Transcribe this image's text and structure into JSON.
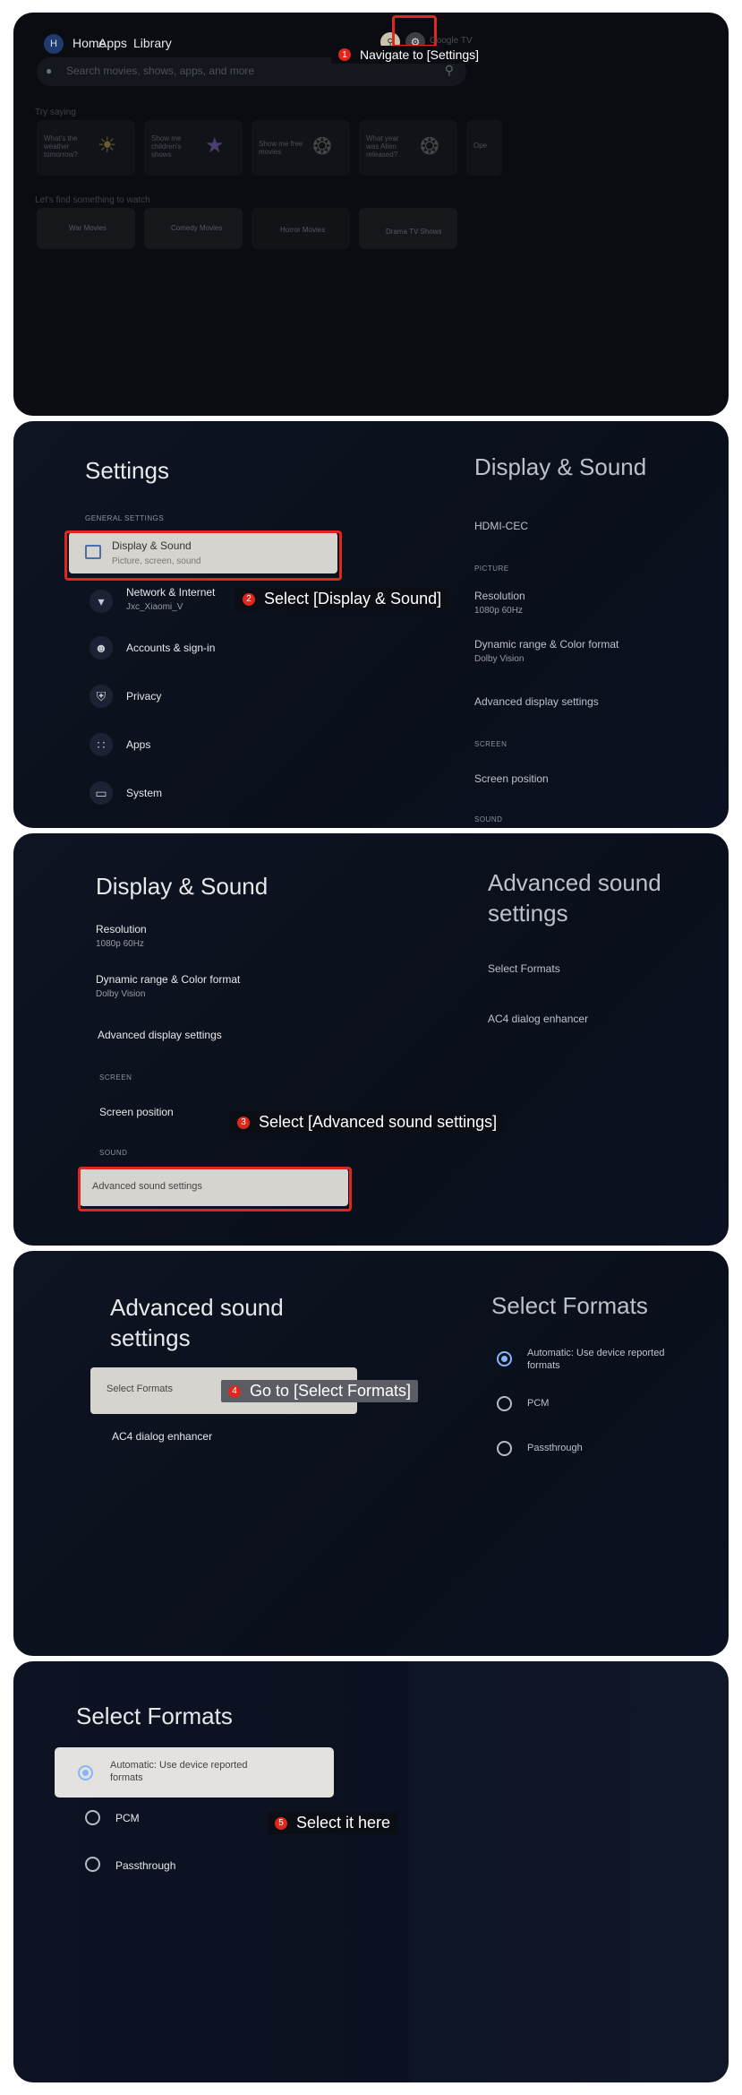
{
  "panel1": {
    "avatar": "H",
    "nav": [
      "Home",
      "Apps",
      "Library"
    ],
    "brand": "Google TV",
    "search_placeholder": "Search movies, shows, apps, and more",
    "try_saying": "Try saying",
    "suggestions": [
      "What's the weather tomorrow?",
      "Show me children's shows",
      "Show me free movies",
      "What year was Alien released?",
      "Ope"
    ],
    "find_title": "Let's find something to watch",
    "genres": [
      "War Movies",
      "Comedy Movies",
      "Horror Movies",
      "Drama TV Shows"
    ],
    "step_num": "1",
    "step_label": "Navigate to [Settings]"
  },
  "panel2": {
    "title": "Settings",
    "section": "GENERAL SETTINGS",
    "items": [
      {
        "label": "Display & Sound",
        "sub": "Picture, screen, sound"
      },
      {
        "label": "Network & Internet",
        "sub": "Jxc_Xiaomi_V"
      },
      {
        "label": "Accounts & sign-in",
        "sub": ""
      },
      {
        "label": "Privacy",
        "sub": ""
      },
      {
        "label": "Apps",
        "sub": ""
      },
      {
        "label": "System",
        "sub": ""
      }
    ],
    "right_title": "Display & Sound",
    "right_hdmi": "HDMI-CEC",
    "right_picture": "PICTURE",
    "right_resolution": "Resolution",
    "right_resolution_val": "1080p 60Hz",
    "right_dynamic": "Dynamic range & Color format",
    "right_dynamic_val": "Dolby Vision",
    "right_advanced": "Advanced display settings",
    "right_screen": "SCREEN",
    "right_screen_pos": "Screen position",
    "right_sound": "SOUND",
    "step_num": "2",
    "step_label": "Select [Display & Sound]"
  },
  "panel3": {
    "title": "Display & Sound",
    "resolution": "Resolution",
    "resolution_val": "1080p 60Hz",
    "dynamic": "Dynamic range & Color format",
    "dynamic_val": "Dolby Vision",
    "advanced_display": "Advanced display settings",
    "screen_cap": "SCREEN",
    "screen_pos": "Screen position",
    "sound_cap": "SOUND",
    "advanced_sound": "Advanced sound settings",
    "right_title_1": "Advanced sound",
    "right_title_2": "settings",
    "right_item1": "Select Formats",
    "right_item2": "AC4 dialog enhancer",
    "step_num": "3",
    "step_label": "Select [Advanced sound settings]"
  },
  "panel4": {
    "title_1": "Advanced sound",
    "title_2": "settings",
    "item1": "Select Formats",
    "item2": "AC4 dialog enhancer",
    "right_title": "Select Formats",
    "opt1_1": "Automatic: Use device reported",
    "opt1_2": "formats",
    "opt2": "PCM",
    "opt3": "Passthrough",
    "step_num": "4",
    "step_label": "Go to [Select Formats]"
  },
  "panel5": {
    "title": "Select Formats",
    "opt1_1": "Automatic: Use device reported",
    "opt1_2": "formats",
    "opt2": "PCM",
    "opt3": "Passthrough",
    "step_num": "5",
    "step_label": "Select it here"
  }
}
